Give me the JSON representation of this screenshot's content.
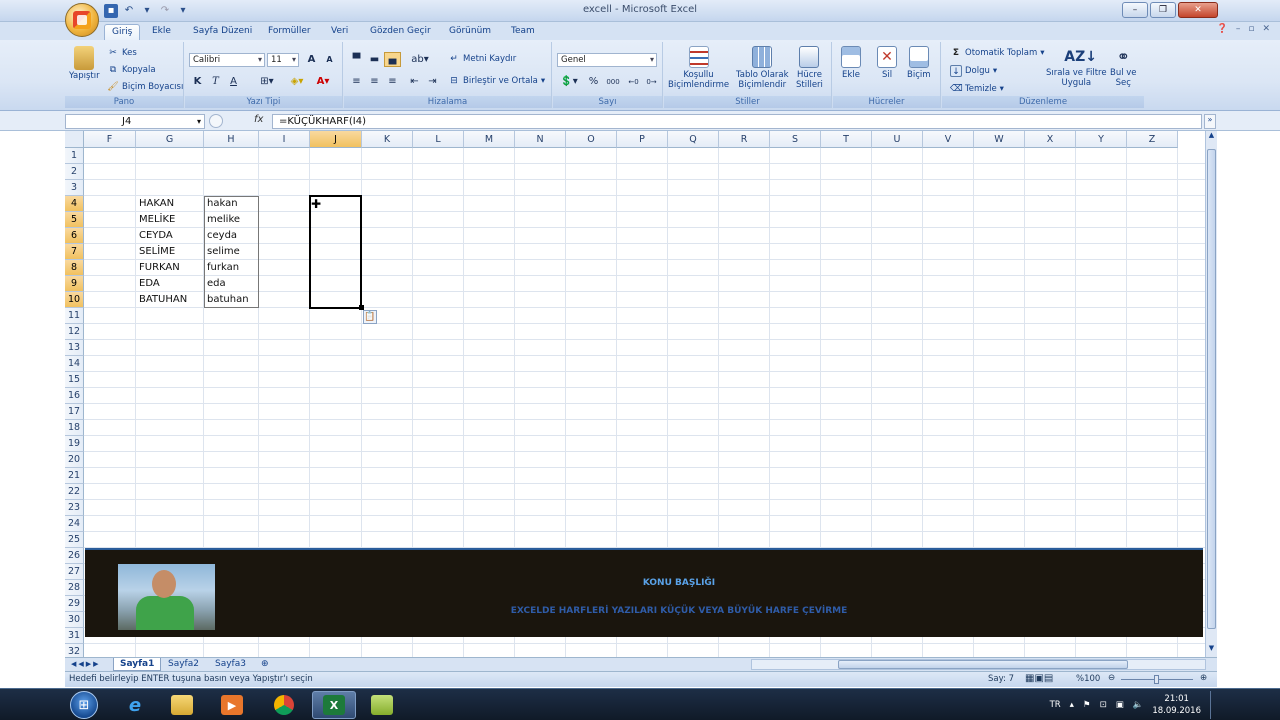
{
  "window": {
    "title": "excell - Microsoft Excel"
  },
  "tabs": [
    {
      "label": "Giriş",
      "active": true
    },
    {
      "label": "Ekle"
    },
    {
      "label": "Sayfa Düzeni"
    },
    {
      "label": "Formüller"
    },
    {
      "label": "Veri"
    },
    {
      "label": "Gözden Geçir"
    },
    {
      "label": "Görünüm"
    },
    {
      "label": "Team"
    }
  ],
  "ribbon": {
    "pano": {
      "label": "Pano",
      "paste": "Yapıştır",
      "cut": "Kes",
      "copy": "Kopyala",
      "format_painter": "Biçim Boyacısı"
    },
    "font": {
      "label": "Yazı Tipi",
      "family": "Calibri",
      "size": "11",
      "bold": "K",
      "italic": "T",
      "underline": "A",
      "color_a": "A"
    },
    "align": {
      "label": "Hizalama",
      "wrap": "Metni Kaydır",
      "merge": "Birleştir ve Ortala"
    },
    "number": {
      "label": "Sayı",
      "format": "Genel",
      "percent": "%",
      "thousands": "000"
    },
    "styles": {
      "label": "Stiller",
      "conditional_1": "Koşullu",
      "conditional_2": "Biçimlendirme",
      "table_1": "Tablo Olarak",
      "table_2": "Biçimlendir",
      "cell_styles_1": "Hücre",
      "cell_styles_2": "Stilleri"
    },
    "cells": {
      "label": "Hücreler",
      "insert": "Ekle",
      "delete": "Sil",
      "format": "Biçim"
    },
    "editing": {
      "label": "Düzenleme",
      "autosum": "Otomatik Toplam",
      "fill": "Dolgu",
      "clear": "Temizle",
      "sort_1": "Sırala ve Filtre",
      "sort_2": "Uygula",
      "find_1": "Bul ve",
      "find_2": "Seç"
    }
  },
  "formula_bar": {
    "name_box": "J4",
    "fx": "fx",
    "formula": "=KÜÇÜKHARF(I4)"
  },
  "columns": [
    "F",
    "G",
    "H",
    "I",
    "J",
    "K",
    "L",
    "M",
    "N",
    "O",
    "P",
    "Q",
    "R",
    "S",
    "T",
    "U",
    "V",
    "W",
    "X",
    "Y",
    "Z"
  ],
  "selected_column": "J",
  "rows": [
    "1",
    "2",
    "3",
    "4",
    "5",
    "6",
    "7",
    "8",
    "9",
    "10",
    "11",
    "12",
    "13",
    "14",
    "15",
    "16",
    "17",
    "18",
    "19",
    "20",
    "21",
    "22",
    "23",
    "24",
    "25",
    "26",
    "27",
    "28",
    "29",
    "30",
    "31",
    "32"
  ],
  "selected_rows": [
    "4",
    "5",
    "6",
    "7",
    "8",
    "9",
    "10"
  ],
  "cells": {
    "G": [
      "HAKAN",
      "MELİKE",
      "CEYDA",
      "SELİME",
      "FURKAN",
      "EDA",
      "BATUHAN"
    ],
    "H": [
      "hakan",
      "melike",
      "ceyda",
      "selime",
      "furkan",
      "eda",
      "batuhan"
    ]
  },
  "banner": {
    "title": "KONU BAŞLIĞI",
    "subtitle": "EXCELDE HARFLERİ  YAZILARI  KÜÇÜK VEYA BÜYÜK HARFE  ÇEVİRME",
    "background": "#1a150d"
  },
  "sheet_tabs": [
    {
      "label": "Sayfa1",
      "active": true
    },
    {
      "label": "Sayfa2"
    },
    {
      "label": "Sayfa3"
    }
  ],
  "status": {
    "message": "Hedefi belirleyip ENTER tuşuna basın veya Yapıştır'ı seçin",
    "count": "Say: 7",
    "zoom": "%100"
  },
  "taskbar": {
    "lang": "TR",
    "time": "21:01",
    "date": "18.09.2016"
  },
  "colors": {
    "accent": "#15428b",
    "selection_header": "#f1c15f",
    "banner_title": "#5aa2e8",
    "banner_sub": "#2f5ca8"
  }
}
